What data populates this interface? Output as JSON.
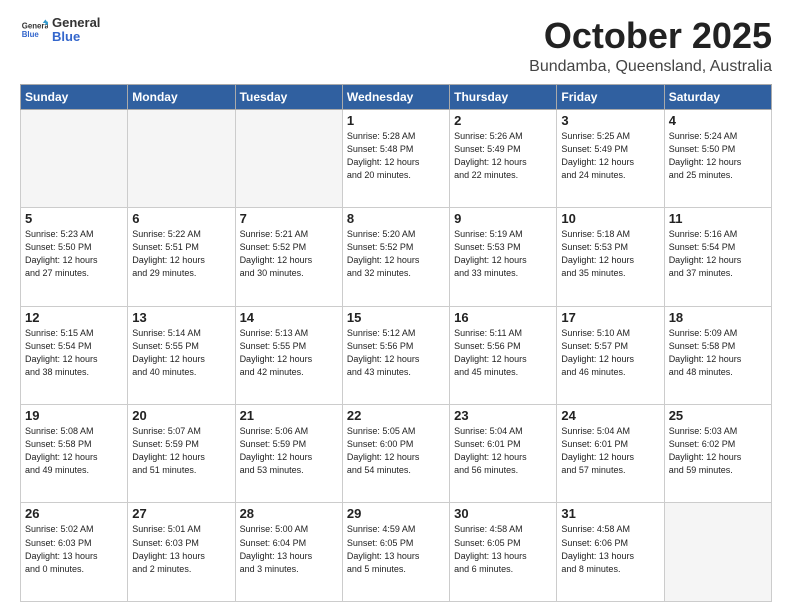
{
  "header": {
    "logo_general": "General",
    "logo_blue": "Blue",
    "month_title": "October 2025",
    "location": "Bundamba, Queensland, Australia"
  },
  "weekdays": [
    "Sunday",
    "Monday",
    "Tuesday",
    "Wednesday",
    "Thursday",
    "Friday",
    "Saturday"
  ],
  "weeks": [
    [
      {
        "day": "",
        "info": ""
      },
      {
        "day": "",
        "info": ""
      },
      {
        "day": "",
        "info": ""
      },
      {
        "day": "1",
        "info": "Sunrise: 5:28 AM\nSunset: 5:48 PM\nDaylight: 12 hours\nand 20 minutes."
      },
      {
        "day": "2",
        "info": "Sunrise: 5:26 AM\nSunset: 5:49 PM\nDaylight: 12 hours\nand 22 minutes."
      },
      {
        "day": "3",
        "info": "Sunrise: 5:25 AM\nSunset: 5:49 PM\nDaylight: 12 hours\nand 24 minutes."
      },
      {
        "day": "4",
        "info": "Sunrise: 5:24 AM\nSunset: 5:50 PM\nDaylight: 12 hours\nand 25 minutes."
      }
    ],
    [
      {
        "day": "5",
        "info": "Sunrise: 5:23 AM\nSunset: 5:50 PM\nDaylight: 12 hours\nand 27 minutes."
      },
      {
        "day": "6",
        "info": "Sunrise: 5:22 AM\nSunset: 5:51 PM\nDaylight: 12 hours\nand 29 minutes."
      },
      {
        "day": "7",
        "info": "Sunrise: 5:21 AM\nSunset: 5:52 PM\nDaylight: 12 hours\nand 30 minutes."
      },
      {
        "day": "8",
        "info": "Sunrise: 5:20 AM\nSunset: 5:52 PM\nDaylight: 12 hours\nand 32 minutes."
      },
      {
        "day": "9",
        "info": "Sunrise: 5:19 AM\nSunset: 5:53 PM\nDaylight: 12 hours\nand 33 minutes."
      },
      {
        "day": "10",
        "info": "Sunrise: 5:18 AM\nSunset: 5:53 PM\nDaylight: 12 hours\nand 35 minutes."
      },
      {
        "day": "11",
        "info": "Sunrise: 5:16 AM\nSunset: 5:54 PM\nDaylight: 12 hours\nand 37 minutes."
      }
    ],
    [
      {
        "day": "12",
        "info": "Sunrise: 5:15 AM\nSunset: 5:54 PM\nDaylight: 12 hours\nand 38 minutes."
      },
      {
        "day": "13",
        "info": "Sunrise: 5:14 AM\nSunset: 5:55 PM\nDaylight: 12 hours\nand 40 minutes."
      },
      {
        "day": "14",
        "info": "Sunrise: 5:13 AM\nSunset: 5:55 PM\nDaylight: 12 hours\nand 42 minutes."
      },
      {
        "day": "15",
        "info": "Sunrise: 5:12 AM\nSunset: 5:56 PM\nDaylight: 12 hours\nand 43 minutes."
      },
      {
        "day": "16",
        "info": "Sunrise: 5:11 AM\nSunset: 5:56 PM\nDaylight: 12 hours\nand 45 minutes."
      },
      {
        "day": "17",
        "info": "Sunrise: 5:10 AM\nSunset: 5:57 PM\nDaylight: 12 hours\nand 46 minutes."
      },
      {
        "day": "18",
        "info": "Sunrise: 5:09 AM\nSunset: 5:58 PM\nDaylight: 12 hours\nand 48 minutes."
      }
    ],
    [
      {
        "day": "19",
        "info": "Sunrise: 5:08 AM\nSunset: 5:58 PM\nDaylight: 12 hours\nand 49 minutes."
      },
      {
        "day": "20",
        "info": "Sunrise: 5:07 AM\nSunset: 5:59 PM\nDaylight: 12 hours\nand 51 minutes."
      },
      {
        "day": "21",
        "info": "Sunrise: 5:06 AM\nSunset: 5:59 PM\nDaylight: 12 hours\nand 53 minutes."
      },
      {
        "day": "22",
        "info": "Sunrise: 5:05 AM\nSunset: 6:00 PM\nDaylight: 12 hours\nand 54 minutes."
      },
      {
        "day": "23",
        "info": "Sunrise: 5:04 AM\nSunset: 6:01 PM\nDaylight: 12 hours\nand 56 minutes."
      },
      {
        "day": "24",
        "info": "Sunrise: 5:04 AM\nSunset: 6:01 PM\nDaylight: 12 hours\nand 57 minutes."
      },
      {
        "day": "25",
        "info": "Sunrise: 5:03 AM\nSunset: 6:02 PM\nDaylight: 12 hours\nand 59 minutes."
      }
    ],
    [
      {
        "day": "26",
        "info": "Sunrise: 5:02 AM\nSunset: 6:03 PM\nDaylight: 13 hours\nand 0 minutes."
      },
      {
        "day": "27",
        "info": "Sunrise: 5:01 AM\nSunset: 6:03 PM\nDaylight: 13 hours\nand 2 minutes."
      },
      {
        "day": "28",
        "info": "Sunrise: 5:00 AM\nSunset: 6:04 PM\nDaylight: 13 hours\nand 3 minutes."
      },
      {
        "day": "29",
        "info": "Sunrise: 4:59 AM\nSunset: 6:05 PM\nDaylight: 13 hours\nand 5 minutes."
      },
      {
        "day": "30",
        "info": "Sunrise: 4:58 AM\nSunset: 6:05 PM\nDaylight: 13 hours\nand 6 minutes."
      },
      {
        "day": "31",
        "info": "Sunrise: 4:58 AM\nSunset: 6:06 PM\nDaylight: 13 hours\nand 8 minutes."
      },
      {
        "day": "",
        "info": ""
      }
    ]
  ]
}
